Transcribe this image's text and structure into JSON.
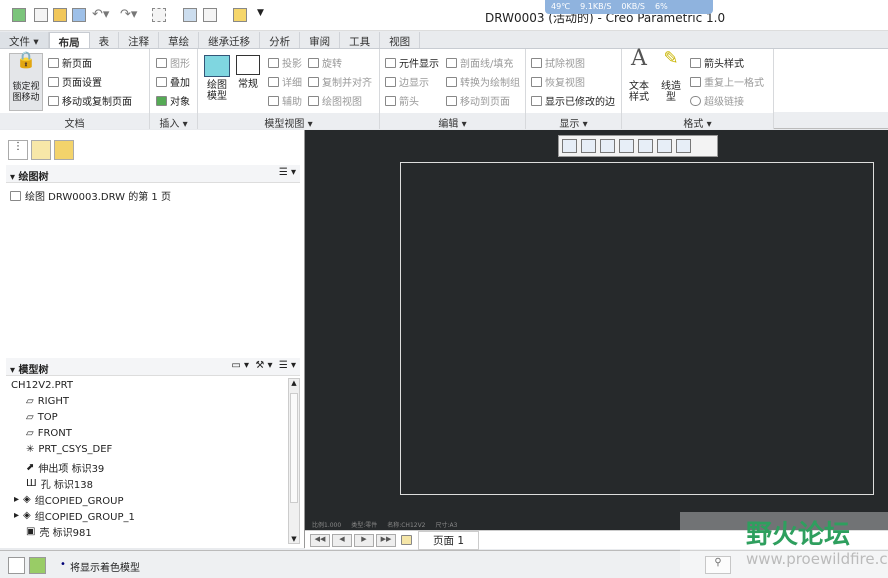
{
  "title": "DRW0003 (活动的) - Creo Parametric 1.0",
  "netbar": {
    "temp": "49℃",
    "down": "9.1KB/S",
    "up": "0KB/S",
    "cpu": "6%"
  },
  "tabs": [
    "文件",
    "布局",
    "表",
    "注释",
    "草绘",
    "继承迁移",
    "分析",
    "审阅",
    "工具",
    "视图"
  ],
  "ribbon": {
    "doc": {
      "lock": "锁定视图移动",
      "new_page": "新页面",
      "page_setup": "页面设置",
      "move_copy": "移动或复制页面",
      "label": "文档"
    },
    "insert": {
      "graphic": "图形",
      "overlay": "叠加",
      "object": "对象",
      "label": "插入"
    },
    "model_views": {
      "drawing_model": "绘图模型",
      "general": "常规",
      "projection": "投影",
      "detail": "详细",
      "auxiliary": "辅助",
      "revolve": "旋转",
      "copy_align": "复制并对齐",
      "drawing_view": "绘图视图",
      "label": "模型视图"
    },
    "edit": {
      "comp_display": "元件显示",
      "edge_display": "边显示",
      "arrow": "箭头",
      "hatch": "剖面线/填充",
      "convert": "转换为绘制组",
      "move_page": "移动到页面",
      "label": "编辑"
    },
    "display": {
      "erase": "拭除视图",
      "resume": "恢复视图",
      "show_modified": "显示已修改的边",
      "label": "显示"
    },
    "format": {
      "text_style": "文本样式",
      "line_style": "线造型",
      "arrow_style": "箭头样式",
      "repeat": "重复上一格式",
      "hyperlink": "超级链接",
      "label": "格式"
    }
  },
  "drawing_tree": {
    "header": "绘图树",
    "items": [
      "绘图 DRW0003.DRW 的第 1 页"
    ]
  },
  "model_tree": {
    "header": "模型树",
    "root": "CH12V2.PRT",
    "items": [
      "RIGHT",
      "TOP",
      "FRONT",
      "PRT_CSYS_DEF",
      "伸出项 标识39",
      "孔 标识138",
      "组COPIED_GROUP",
      "组COPIED_GROUP_1",
      "壳 标识981"
    ]
  },
  "canvas_status": [
    "比例1.000",
    "类型:零件",
    "名称:CH12V2",
    "尺寸:A3"
  ],
  "page_label": "页面 1",
  "status_message": "将显示着色模型",
  "watermark": {
    "text": "野火论坛",
    "url": "www.proewildfire.cn"
  }
}
